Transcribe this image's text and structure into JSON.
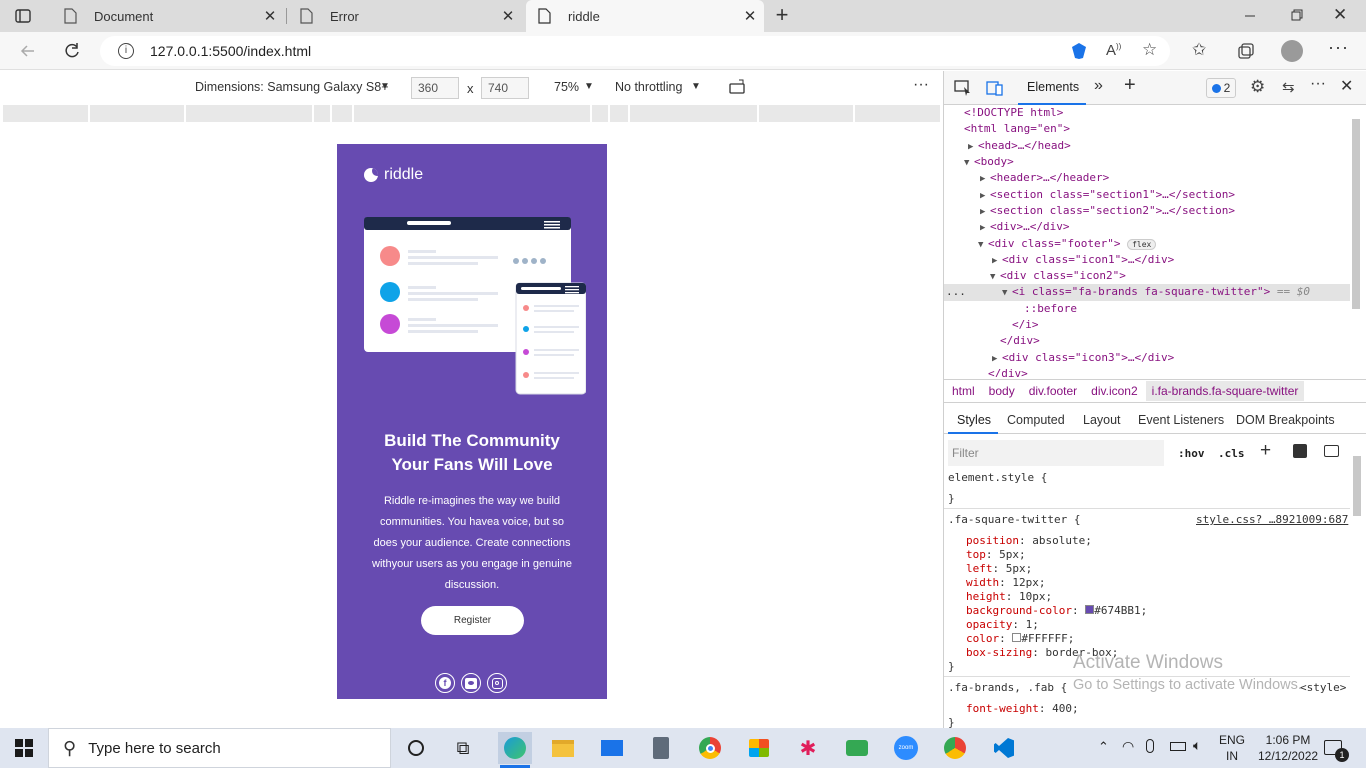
{
  "browser": {
    "tabs": [
      {
        "title": "Document",
        "active": false
      },
      {
        "title": "Error",
        "active": false
      },
      {
        "title": "riddle",
        "active": true
      }
    ],
    "url": "127.0.0.1:5500/index.html"
  },
  "device_toolbar": {
    "dimensions": "Dimensions: Samsung Galaxy S8+",
    "width": "360",
    "times": "x",
    "height": "740",
    "zoom": "75%",
    "throttling": "No throttling"
  },
  "page": {
    "logo_text": "riddle",
    "headline": "Build The Community Your Fans Will Love",
    "body": "Riddle re-imagines the way we build communities. You havea voice, but so does your audience. Create connections withyour users as you engage in genuine discussion.",
    "register_label": "Register"
  },
  "devtools": {
    "elements_tab": "Elements",
    "issues_count": "2",
    "dom_lines": [
      {
        "indent": 0,
        "html": "<!DOCTYPE html>"
      },
      {
        "indent": 0,
        "html": "<html lang=\"en\">"
      },
      {
        "indent": 1,
        "html": "<head>…</head>"
      },
      {
        "indent": 1,
        "html": "<body>"
      },
      {
        "indent": 2,
        "html": "<header>…</header>"
      },
      {
        "indent": 2,
        "html": "<section class=\"section1\">…</section>"
      },
      {
        "indent": 2,
        "html": "<section class=\"section2\">…</section>"
      },
      {
        "indent": 2,
        "html": "<div>…</div>"
      },
      {
        "indent": 2,
        "html": "<div class=\"footer\">"
      },
      {
        "indent": 3,
        "html": "<div class=\"icon1\">…</div>"
      },
      {
        "indent": 3,
        "html": "<div class=\"icon2\">"
      },
      {
        "indent": 4,
        "html": "<i class=\"fa-brands fa-square-twitter\">"
      },
      {
        "indent": 5,
        "html": "::before"
      },
      {
        "indent": 4,
        "html": "</i>"
      },
      {
        "indent": 3,
        "html": "</div>"
      },
      {
        "indent": 3,
        "html": "<div class=\"icon3\">…</div>"
      },
      {
        "indent": 2,
        "html": "</div>"
      }
    ],
    "flex_badge": "flex",
    "selected_suffix": "== $0",
    "ellipsis": "...",
    "breadcrumbs": [
      "html",
      "body",
      "div.footer",
      "div.icon2",
      "i.fa-brands.fa-square-twitter"
    ],
    "style_tabs": [
      "Styles",
      "Computed",
      "Layout",
      "Event Listeners",
      "DOM Breakpoints"
    ],
    "filter_placeholder": "Filter",
    "hov": ":hov",
    "cls": ".cls",
    "element_style": "element.style {",
    "close_brace": "}",
    "rule1_selector": ".fa-square-twitter {",
    "rule1_source": "style.css? …8921009:687",
    "rule1_props": [
      {
        "name": "position",
        "value": "absolute;"
      },
      {
        "name": "top",
        "value": "5px;"
      },
      {
        "name": "left",
        "value": "5px;"
      },
      {
        "name": "width",
        "value": "12px;"
      },
      {
        "name": "height",
        "value": "10px;"
      },
      {
        "name": "background-color",
        "value": "#674BB1;",
        "swatch": "#674BB1"
      },
      {
        "name": "opacity",
        "value": "1;"
      },
      {
        "name": "color",
        "value": "#FFFFFF;",
        "swatch": "#FFFFFF"
      },
      {
        "name": "box-sizing",
        "value": "border-box;"
      }
    ],
    "rule2_selector": ".fa-brands, .fab {",
    "rule2_source": "<style>",
    "rule2_prop_name": "font-weight",
    "rule2_prop_value": "400;"
  },
  "watermark": {
    "line1": "Activate Windows",
    "line2": "Go to Settings to activate Windows."
  },
  "taskbar": {
    "search_placeholder": "Type here to search",
    "lang1": "ENG",
    "lang2": "IN",
    "time": "1:06 PM",
    "date": "12/12/2022",
    "notif_count": "1"
  }
}
